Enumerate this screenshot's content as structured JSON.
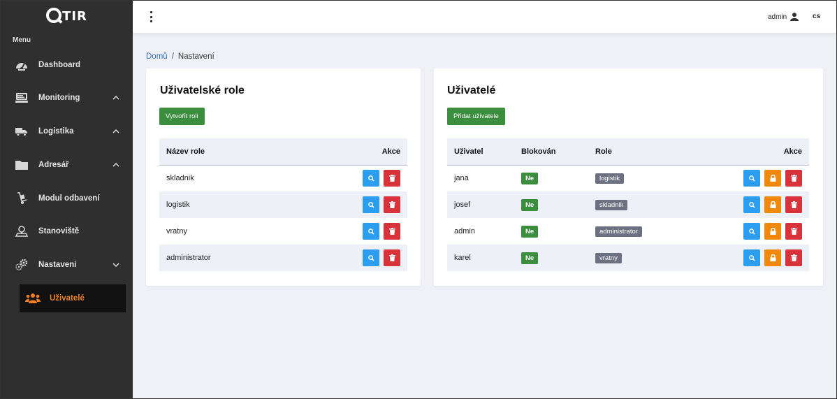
{
  "app": {
    "logo_text": "TIR",
    "menu_label": "Menu"
  },
  "sidebar": {
    "items": [
      {
        "label": "Dashboard"
      },
      {
        "label": "Monitoring"
      },
      {
        "label": "Logistika"
      },
      {
        "label": "Adresář"
      },
      {
        "label": "Modul odbavení"
      },
      {
        "label": "Stanoviště"
      },
      {
        "label": "Nastavení"
      }
    ],
    "sub_item": {
      "label": "Uživatelé"
    }
  },
  "topbar": {
    "user": "admin",
    "lang": "cs"
  },
  "breadcrumb": {
    "home": "Domů",
    "separator": "/",
    "current": "Nastavení"
  },
  "roles_card": {
    "title": "Uživatelské role",
    "create_button": "Vytvořit roli",
    "columns": [
      "Název role",
      "Akce"
    ],
    "rows": [
      {
        "name": "skladnik"
      },
      {
        "name": "logistik"
      },
      {
        "name": "vratny"
      },
      {
        "name": "administrator"
      }
    ]
  },
  "users_card": {
    "title": "Uživatelé",
    "add_button": "Přidat uživatele",
    "columns": [
      "Uživatel",
      "Blokován",
      "Role",
      "Akce"
    ],
    "rows": [
      {
        "user": "jana",
        "blocked": "Ne",
        "role": "logistik"
      },
      {
        "user": "josef",
        "blocked": "Ne",
        "role": "skladnik"
      },
      {
        "user": "admin",
        "blocked": "Ne",
        "role": "administrator"
      },
      {
        "user": "karel",
        "blocked": "Ne",
        "role": "vratny"
      }
    ]
  },
  "colors": {
    "sidebar_bg": "#2f2f2f",
    "accent_orange": "#f08020",
    "green": "#3a8e3e",
    "blue": "#2c9ef0",
    "red": "#d8333a",
    "orange": "#f0890b"
  },
  "icons": {
    "search": "search-icon",
    "delete": "trash-icon",
    "lock": "lock-icon",
    "user": "user-icon"
  }
}
